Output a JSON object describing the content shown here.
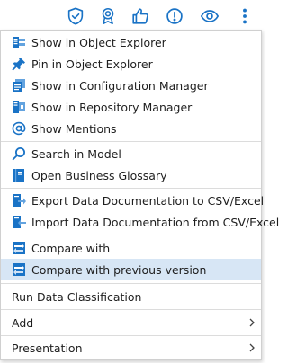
{
  "toolbar": {
    "icons": [
      "shield-check-icon",
      "award-ribbon-icon",
      "thumbs-up-icon",
      "alert-circle-icon",
      "eye-icon",
      "more-vertical-icon"
    ],
    "accent": "#1a73c6"
  },
  "menu": {
    "items": [
      {
        "label": "Show in Object Explorer",
        "icon": "object-explorer-icon"
      },
      {
        "label": "Pin in Object Explorer",
        "icon": "pin-icon"
      },
      {
        "label": "Show in Configuration Manager",
        "icon": "configuration-manager-icon"
      },
      {
        "label": "Show in Repository Manager",
        "icon": "repository-manager-icon"
      },
      {
        "label": "Show Mentions",
        "icon": "at-sign-icon"
      },
      {
        "label": "Search in Model",
        "icon": "search-icon"
      },
      {
        "label": "Open Business Glossary",
        "icon": "glossary-book-icon"
      },
      {
        "label": "Export Data Documentation to CSV/Excel",
        "icon": "export-icon"
      },
      {
        "label": "Import Data Documentation from CSV/Excel",
        "icon": "import-icon"
      },
      {
        "label": "Compare with",
        "icon": "compare-icon"
      },
      {
        "label": "Compare with previous version",
        "icon": "compare-icon",
        "selected": true
      },
      {
        "label": "Run Data Classification"
      },
      {
        "label": "Add",
        "submenu": true
      },
      {
        "label": "Presentation",
        "submenu": true
      }
    ],
    "selected_color": "#d7e6f5"
  },
  "backdrop_text": "..."
}
